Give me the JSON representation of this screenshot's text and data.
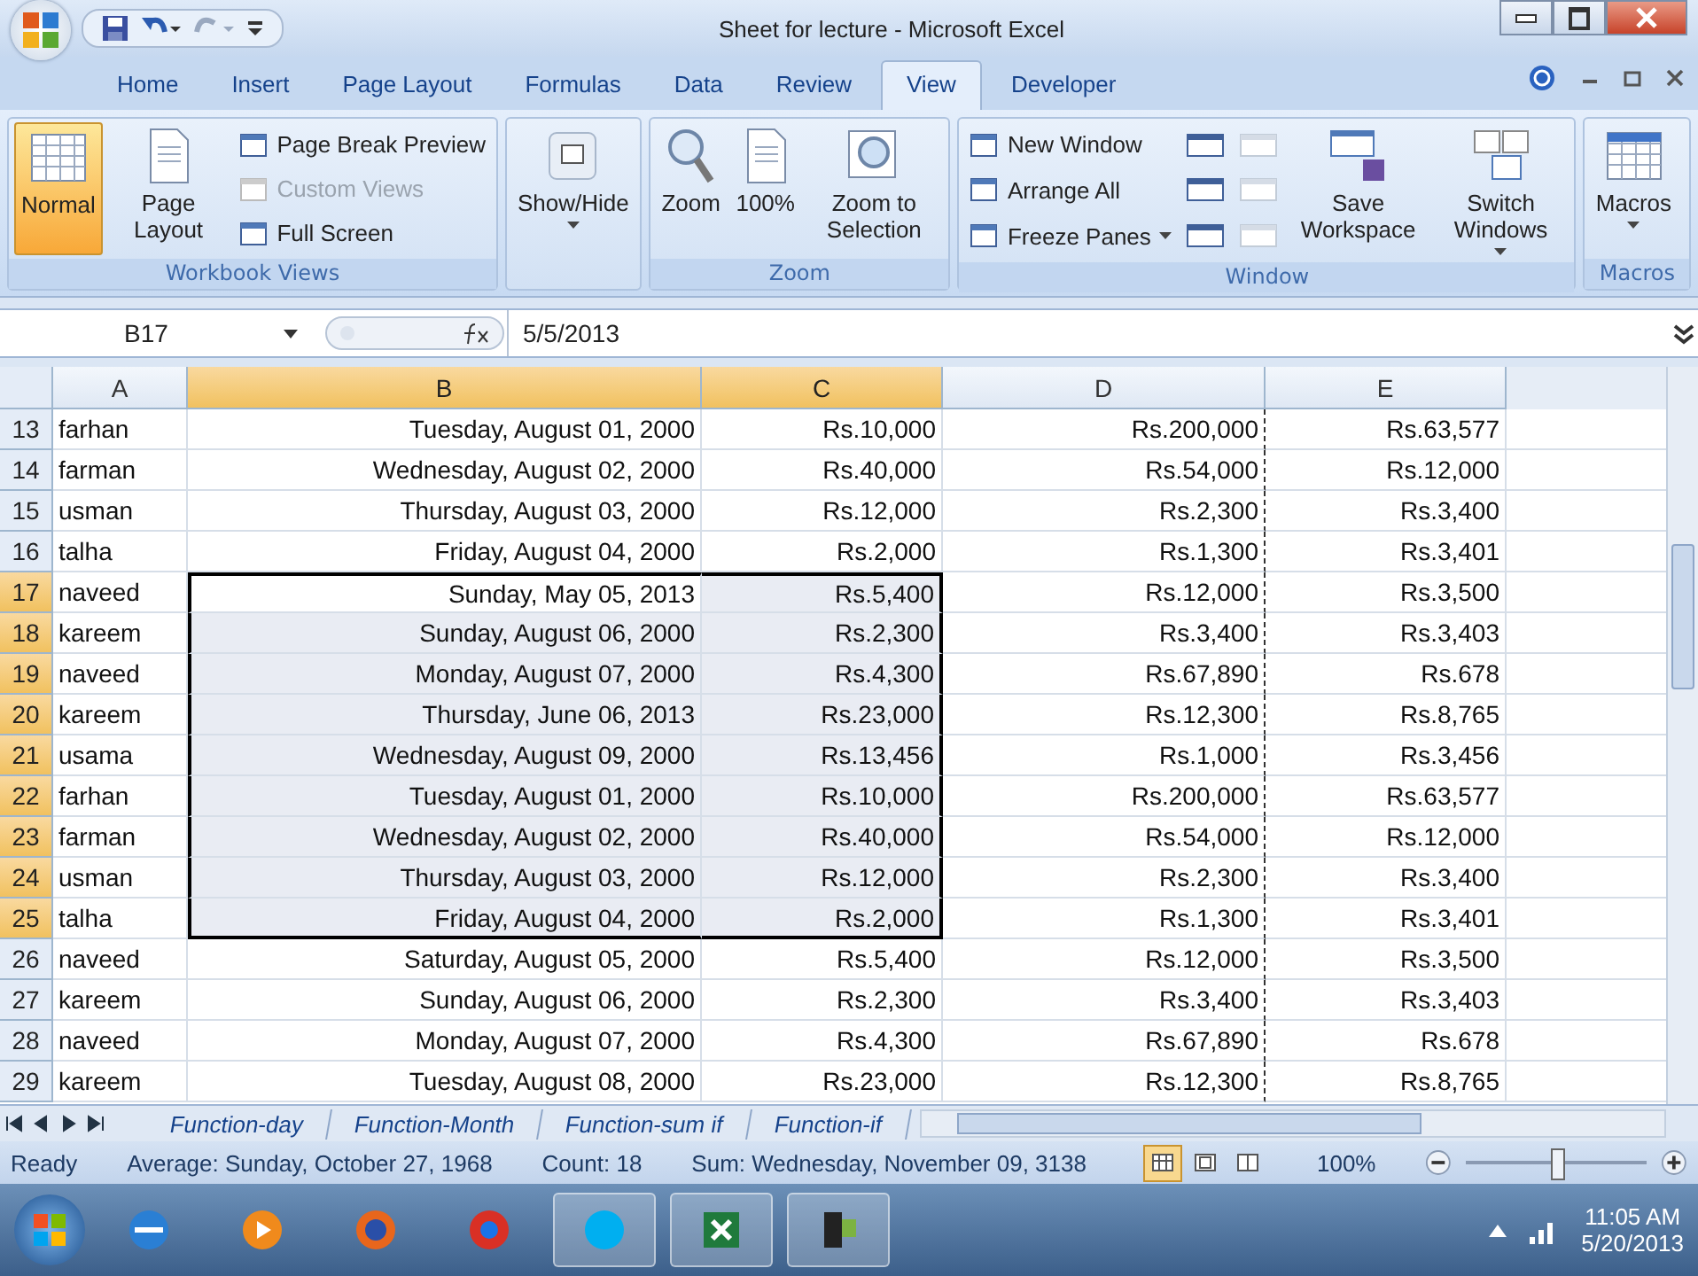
{
  "window": {
    "title": "Sheet for lecture - Microsoft Excel"
  },
  "ribbon_tabs": [
    {
      "label": "Home",
      "selected": false
    },
    {
      "label": "Insert",
      "selected": false
    },
    {
      "label": "Page Layout",
      "selected": false
    },
    {
      "label": "Formulas",
      "selected": false
    },
    {
      "label": "Data",
      "selected": false
    },
    {
      "label": "Review",
      "selected": false
    },
    {
      "label": "View",
      "selected": true
    },
    {
      "label": "Developer",
      "selected": false
    }
  ],
  "ribbon_groups": [
    {
      "label": "Workbook Views",
      "items": [
        {
          "kind": "large",
          "label": "Normal",
          "selected": true,
          "dropdown": false
        },
        {
          "kind": "large",
          "label": "Page Layout",
          "selected": false,
          "dropdown": false
        },
        {
          "kind": "stack",
          "items": [
            {
              "label": "Page Break Preview",
              "disabled": false,
              "dropdown": false
            },
            {
              "label": "Custom Views",
              "disabled": true,
              "dropdown": false
            },
            {
              "label": "Full Screen",
              "disabled": false,
              "dropdown": false
            }
          ]
        }
      ]
    },
    {
      "items": [
        {
          "kind": "large",
          "label": "Show/Hide",
          "selected": false,
          "dropdown": true
        }
      ]
    },
    {
      "label": "Zoom",
      "items": [
        {
          "kind": "large",
          "label": "Zoom",
          "selected": false,
          "dropdown": false
        },
        {
          "kind": "large",
          "label": "100%",
          "selected": false,
          "dropdown": false
        },
        {
          "kind": "large",
          "label": "Zoom to Selection",
          "selected": false,
          "dropdown": false
        }
      ]
    },
    {
      "label": "Window",
      "items": [
        {
          "kind": "stack",
          "items": [
            {
              "label": "New Window",
              "disabled": false,
              "dropdown": false
            },
            {
              "label": "Arrange All",
              "disabled": false,
              "dropdown": false
            },
            {
              "label": "Freeze Panes",
              "disabled": false,
              "dropdown": true
            }
          ]
        },
        {
          "kind": "icon_stack",
          "items": [
            {
              "disabled": false
            },
            {
              "disabled": false
            },
            {
              "disabled": false
            }
          ]
        },
        {
          "kind": "icon_stack",
          "items": [
            {
              "disabled": true
            },
            {
              "disabled": true
            },
            {
              "disabled": true
            }
          ]
        },
        {
          "kind": "large",
          "label": "Save Workspace",
          "selected": false,
          "dropdown": false
        },
        {
          "kind": "large",
          "label": "Switch Windows",
          "selected": false,
          "dropdown": true
        }
      ]
    },
    {
      "label": "Macros",
      "items": [
        {
          "kind": "large",
          "label": "Macros",
          "selected": false,
          "dropdown": true
        }
      ]
    }
  ],
  "formula_bar": {
    "name_box": "B17",
    "formula": "5/5/2013"
  },
  "columns": [
    {
      "label": "A",
      "selected": false
    },
    {
      "label": "B",
      "selected": true
    },
    {
      "label": "C",
      "selected": true
    },
    {
      "label": "D",
      "selected": false
    },
    {
      "label": "E",
      "selected": false
    }
  ],
  "rows": [
    {
      "number": "13",
      "selected": false,
      "cells": [
        "farhan",
        "Tuesday, August 01, 2000",
        "Rs.10,000",
        "Rs.200,000",
        "Rs.63,577"
      ]
    },
    {
      "number": "14",
      "selected": false,
      "cells": [
        "farman",
        "Wednesday, August 02, 2000",
        "Rs.40,000",
        "Rs.54,000",
        "Rs.12,000"
      ]
    },
    {
      "number": "15",
      "selected": false,
      "cells": [
        "usman",
        "Thursday, August 03, 2000",
        "Rs.12,000",
        "Rs.2,300",
        "Rs.3,400"
      ]
    },
    {
      "number": "16",
      "selected": false,
      "cells": [
        "talha",
        "Friday, August 04, 2000",
        "Rs.2,000",
        "Rs.1,300",
        "Rs.3,401"
      ]
    },
    {
      "number": "17",
      "selected": true,
      "cells": [
        "naveed",
        "Sunday, May 05, 2013",
        "Rs.5,400",
        "Rs.12,000",
        "Rs.3,500"
      ]
    },
    {
      "number": "18",
      "selected": true,
      "cells": [
        "kareem",
        "Sunday, August 06, 2000",
        "Rs.2,300",
        "Rs.3,400",
        "Rs.3,403"
      ]
    },
    {
      "number": "19",
      "selected": true,
      "cells": [
        "naveed",
        "Monday, August 07, 2000",
        "Rs.4,300",
        "Rs.67,890",
        "Rs.678"
      ]
    },
    {
      "number": "20",
      "selected": true,
      "cells": [
        "kareem",
        "Thursday, June 06, 2013",
        "Rs.23,000",
        "Rs.12,300",
        "Rs.8,765"
      ]
    },
    {
      "number": "21",
      "selected": true,
      "cells": [
        "usama",
        "Wednesday, August 09, 2000",
        "Rs.13,456",
        "Rs.1,000",
        "Rs.3,456"
      ]
    },
    {
      "number": "22",
      "selected": true,
      "cells": [
        "farhan",
        "Tuesday, August 01, 2000",
        "Rs.10,000",
        "Rs.200,000",
        "Rs.63,577"
      ]
    },
    {
      "number": "23",
      "selected": true,
      "cells": [
        "farman",
        "Wednesday, August 02, 2000",
        "Rs.40,000",
        "Rs.54,000",
        "Rs.12,000"
      ]
    },
    {
      "number": "24",
      "selected": true,
      "cells": [
        "usman",
        "Thursday, August 03, 2000",
        "Rs.12,000",
        "Rs.2,300",
        "Rs.3,400"
      ]
    },
    {
      "number": "25",
      "selected": true,
      "cells": [
        "talha",
        "Friday, August 04, 2000",
        "Rs.2,000",
        "Rs.1,300",
        "Rs.3,401"
      ]
    },
    {
      "number": "26",
      "selected": false,
      "cells": [
        "naveed",
        "Saturday, August 05, 2000",
        "Rs.5,400",
        "Rs.12,000",
        "Rs.3,500"
      ]
    },
    {
      "number": "27",
      "selected": false,
      "cells": [
        "kareem",
        "Sunday, August 06, 2000",
        "Rs.2,300",
        "Rs.3,400",
        "Rs.3,403"
      ]
    },
    {
      "number": "28",
      "selected": false,
      "cells": [
        "naveed",
        "Monday, August 07, 2000",
        "Rs.4,300",
        "Rs.67,890",
        "Rs.678"
      ]
    },
    {
      "number": "29",
      "selected": false,
      "cells": [
        "kareem",
        "Tuesday, August 08, 2000",
        "Rs.23,000",
        "Rs.12,300",
        "Rs.8,765"
      ]
    }
  ],
  "sheet_tabs": [
    {
      "label": "Function-day",
      "selected": false
    },
    {
      "label": "Function-Month",
      "selected": false
    },
    {
      "label": "Function-sum if",
      "selected": false
    },
    {
      "label": "Function-if",
      "selected": false
    }
  ],
  "status_bar": {
    "state": "Ready",
    "average": "Average: Sunday, October 27, 1968",
    "count": "Count: 18",
    "sum": "Sum: Wednesday, November 09, 3138",
    "views": [
      {
        "selected": true
      },
      {
        "selected": false
      },
      {
        "selected": false
      }
    ],
    "zoom": "100%",
    "zoom_level": {
      "level": 0.5
    }
  },
  "taskbar": {
    "time": "11:05 AM",
    "date": "5/20/2013"
  }
}
